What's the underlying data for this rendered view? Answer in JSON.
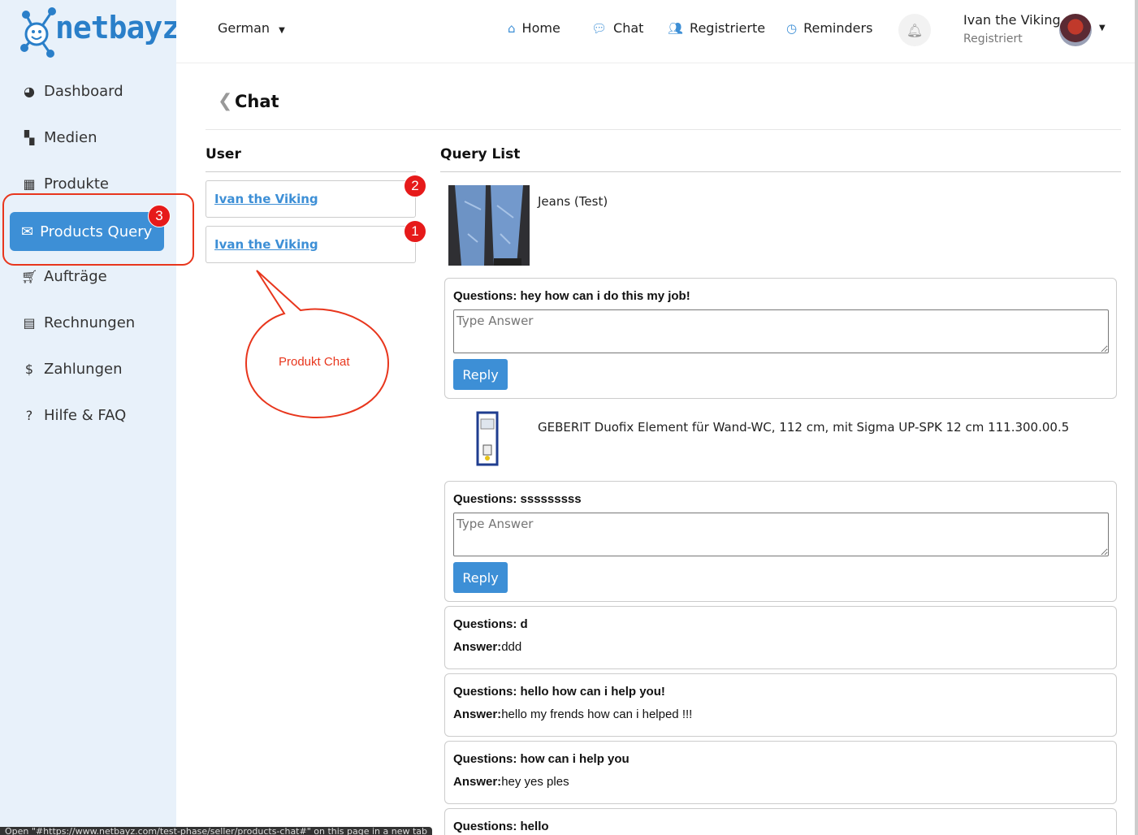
{
  "brand": {
    "name": "netbayz"
  },
  "sidebar": {
    "items": [
      {
        "label": "Dashboard",
        "icon": "dashboard-icon"
      },
      {
        "label": "Medien",
        "icon": "map-icon"
      },
      {
        "label": "Produkte",
        "icon": "grid-icon"
      },
      {
        "label": "Products Query",
        "icon": "envelope-icon",
        "active": true,
        "badge": "3"
      },
      {
        "label": "Aufträge",
        "icon": "cart-icon"
      },
      {
        "label": "Rechnungen",
        "icon": "file-icon"
      },
      {
        "label": "Zahlungen",
        "icon": "dollar-icon"
      },
      {
        "label": "Hilfe & FAQ",
        "icon": "question-icon"
      }
    ]
  },
  "header": {
    "language": "German",
    "nav": [
      {
        "label": "Home",
        "icon": "home-icon"
      },
      {
        "label": "Chat",
        "icon": "comments-icon"
      },
      {
        "label": "Registrierte",
        "icon": "users-icon"
      },
      {
        "label": "Reminders",
        "icon": "clock-icon"
      }
    ],
    "user_name": "Ivan the Viking",
    "user_role": "Registriert"
  },
  "page": {
    "title": "Chat",
    "user_col_title": "User",
    "query_col_title": "Query List"
  },
  "users": [
    {
      "name": "Ivan the Viking",
      "badge": "2"
    },
    {
      "name": "Ivan the Viking",
      "badge": "1"
    }
  ],
  "annotation": {
    "text": "Produkt Chat"
  },
  "products": [
    {
      "name": "Jeans (Test)",
      "queries": [
        {
          "question_label": "Questions: ",
          "question": "hey how can i do this my job!",
          "placeholder": "Type Answer",
          "reply_label": "Reply"
        }
      ]
    },
    {
      "name": "GEBERIT Duofix Element für Wand-WC, 112 cm, mit Sigma UP-SPK 12 cm 111.300.00.5",
      "queries": [
        {
          "question_label": "Questions: ",
          "question": "sssssssss",
          "placeholder": "Type Answer",
          "reply_label": "Reply"
        },
        {
          "question_label": "Questions: ",
          "question": "d",
          "answer_label": "Answer:",
          "answer": "ddd"
        },
        {
          "question_label": "Questions: ",
          "question": "hello how can i help you!",
          "answer_label": "Answer:",
          "answer": "hello my frends how can i helped !!!"
        },
        {
          "question_label": "Questions: ",
          "question": "how can i help you",
          "answer_label": "Answer:",
          "answer": "hey yes ples"
        },
        {
          "question_label": "Questions: ",
          "question": "hello"
        }
      ]
    }
  ],
  "statusbar": {
    "text": "Open \"#https://www.netbayz.com/test-phase/seller/products-chat#\" on this page in a new tab"
  },
  "colors": {
    "accent": "#3d8fd6",
    "annotation_red": "#e8361d",
    "badge_red": "#e61a1a",
    "sidebar_bg": "#e8f1fa"
  }
}
